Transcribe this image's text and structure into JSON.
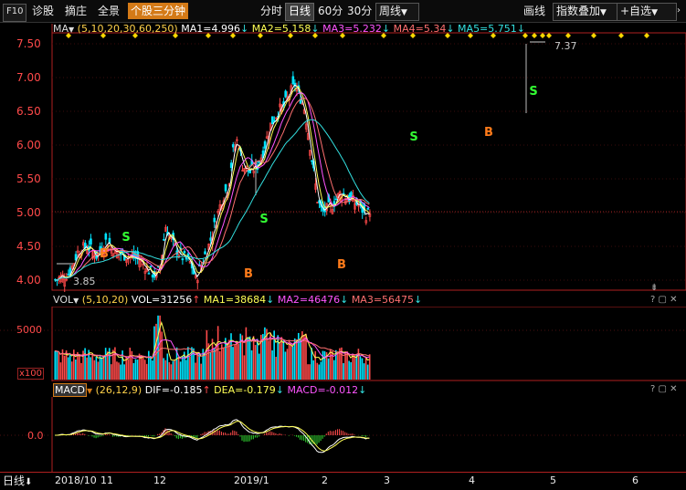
{
  "toolbar": {
    "f10": "F10",
    "diagnose": "诊股",
    "select": "摘庄",
    "panorama": "全景",
    "tool_active": "个股三分钟",
    "periods": [
      "分时",
      "日线",
      "60分",
      "30分"
    ],
    "active_period": "日线",
    "week_select": "周线",
    "draw_line": "画线",
    "overlay": "指数叠加",
    "self_select": "+自选"
  },
  "main_chart": {
    "indicator": "MA",
    "params": "(5,10,20,30,60,250)",
    "ma1": "MA1=4.996",
    "ma2": "MA2=5.158",
    "ma3": "MA3=5.232",
    "ma4": "MA4=5.34",
    "ma5": "MA5=5.751",
    "high_label": "7.37",
    "low_label": "3.85",
    "price_ticks": [
      "7.50",
      "7.00",
      "6.50",
      "6.00",
      "5.50",
      "5.00",
      "4.50",
      "4.00"
    ],
    "signal_S": "S",
    "signal_B": "B"
  },
  "vol_panel": {
    "indicator": "VOL",
    "params": "(5,10,20)",
    "vol": "VOL=31256",
    "ma1": "MA1=38684",
    "ma2": "MA2=46476",
    "ma3": "MA3=56475",
    "tick": "5000",
    "unit": "x100"
  },
  "macd_panel": {
    "indicator": "MACD",
    "params": "(26,12,9)",
    "dif": "DIF=-0.185",
    "dea": "DEA=-0.179",
    "macd": "MACD=-0.012",
    "tick": "0.0"
  },
  "footer": {
    "period_label": "日线",
    "dates": [
      "2018/10",
      "11",
      "12",
      "2019/1",
      "2",
      "3",
      "4",
      "5",
      "6"
    ]
  },
  "colors": {
    "up": "#ff4a4a",
    "down": "#00e5ff",
    "ma1": "#ffffff",
    "ma2": "#ffff55",
    "ma3": "#ff55ff",
    "ma4": "#ff7070",
    "ma5": "#33e0e0",
    "signal_s": "#33ff33",
    "signal_b": "#ff7b1a",
    "diamond": "#ffd700"
  }
}
